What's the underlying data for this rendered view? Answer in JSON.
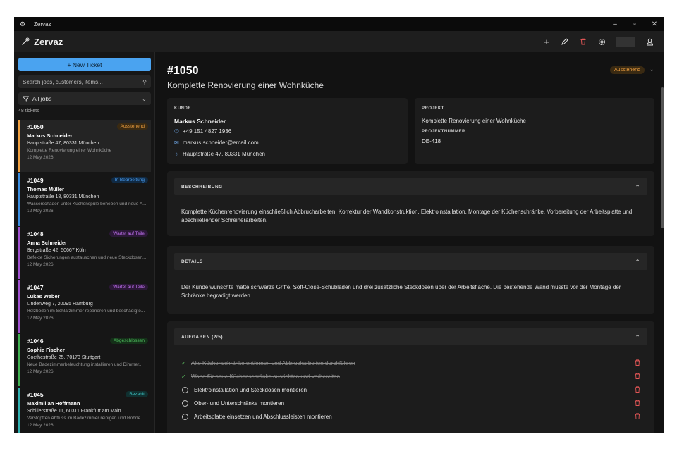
{
  "window": {
    "title": "Zervaz",
    "minimize": "–",
    "restore": "▫",
    "close": "✕"
  },
  "app": {
    "name": "Zervaz"
  },
  "toolbar": {
    "add": "+",
    "edit": "✎",
    "delete": "🗑",
    "settings": "⚙",
    "user": "👤"
  },
  "sidebar": {
    "new_ticket": "+ New Ticket",
    "search_placeholder": "Search jobs, customers, items...",
    "filter": "All jobs",
    "count": "48 tickets",
    "tickets": [
      {
        "num": "#1050",
        "badge": "Ausstehend",
        "customer": "Markus Schneider",
        "address": "Hauptstraße 47, 80331 München",
        "desc": "Komplette Renovierung einer Wohnküche",
        "date": "12 May 2026",
        "color": "#f0a040",
        "badge_bg": "#3a2a12",
        "badge_fg": "#f0a040"
      },
      {
        "num": "#1049",
        "badge": "In Bearbeitung",
        "customer": "Thomas Müller",
        "address": "Hauptstraße 18, 80331 München",
        "desc": "Wasserschaden unter Küchenspüle beheben und neue A...",
        "date": "12 May 2026",
        "color": "#3a8de0",
        "badge_bg": "#102a44",
        "badge_fg": "#4a9cf0"
      },
      {
        "num": "#1048",
        "badge": "Wartet auf Teile",
        "customer": "Anna Schneider",
        "address": "Bergstraße 42, 50667 Köln",
        "desc": "Defekte Sicherungen austauschen und neue Steckdosen...",
        "date": "12 May 2026",
        "color": "#a050d0",
        "badge_bg": "#2c1838",
        "badge_fg": "#c070f0"
      },
      {
        "num": "#1047",
        "badge": "Wartet auf Teile",
        "customer": "Lukas Weber",
        "address": "Lindenweg 7, 20095 Hamburg",
        "desc": "Holzboden im Schlafzimmer reparieren und beschädigte...",
        "date": "12 May 2026",
        "color": "#a050d0",
        "badge_bg": "#2c1838",
        "badge_fg": "#c070f0"
      },
      {
        "num": "#1046",
        "badge": "Abgeschlossen",
        "customer": "Sophie Fischer",
        "address": "Goethestraße 25, 70173 Stuttgart",
        "desc": "Neue Badezimmerbeleuchtung installieren und Dimmer...",
        "date": "12 May 2026",
        "color": "#40b050",
        "badge_bg": "#143018",
        "badge_fg": "#50c060"
      },
      {
        "num": "#1045",
        "badge": "Bezahlt",
        "customer": "Maximilian Hoffmann",
        "address": "Schillerstraße 11, 60311 Frankfurt am Main",
        "desc": "Verstopften Abfluss im Badezimmer reinigen und Rohrle...",
        "date": "12 May 2026",
        "color": "#30b0b0",
        "badge_bg": "#103030",
        "badge_fg": "#40c8c8"
      }
    ]
  },
  "detail": {
    "number": "#1050",
    "title": "Komplette Renovierung einer Wohnküche",
    "status": "Ausstehend",
    "customer": {
      "label": "KUNDE",
      "name": "Markus Schneider",
      "phone": "+49 151 4827 1936",
      "email": "markus.schneider@email.com",
      "address": "Hauptstraße 47, 80331 München"
    },
    "project": {
      "label": "PROJEKT",
      "name": "Komplette Renovierung einer Wohnküche",
      "number_label": "PROJEKTNUMMER",
      "number": "DE-418"
    },
    "description": {
      "label": "BESCHREIBUNG",
      "text": "Komplette Küchenrenovierung einschließlich Abbrucharbeiten, Korrektur der Wandkonstruktion, Elektroinstallation, Montage der Küchenschränke, Vorbereitung der Arbeitsplatte und abschließender Schreinerarbeiten."
    },
    "details": {
      "label": "DETAILS",
      "text": "Der Kunde wünschte matte schwarze Griffe, Soft-Close-Schubladen und drei zusätzliche Steckdosen über der Arbeitsfläche. Die bestehende Wand musste vor der Montage der Schränke begradigt werden."
    },
    "tasks": {
      "label": "AUFGABEN (2/5)",
      "items": [
        {
          "text": "Alte Küchenschränke entfernen und Abbrucharbeiten durchführen",
          "done": true
        },
        {
          "text": "Wand für neue Küchenschränke ausrichten und vorbereiten",
          "done": true
        },
        {
          "text": "Elektroinstallation und Steckdosen montieren",
          "done": false
        },
        {
          "text": "Ober- und Unterschränke montieren",
          "done": false
        },
        {
          "text": "Arbeitsplatte einsetzen und Abschlussleisten montieren",
          "done": false
        }
      ]
    }
  }
}
